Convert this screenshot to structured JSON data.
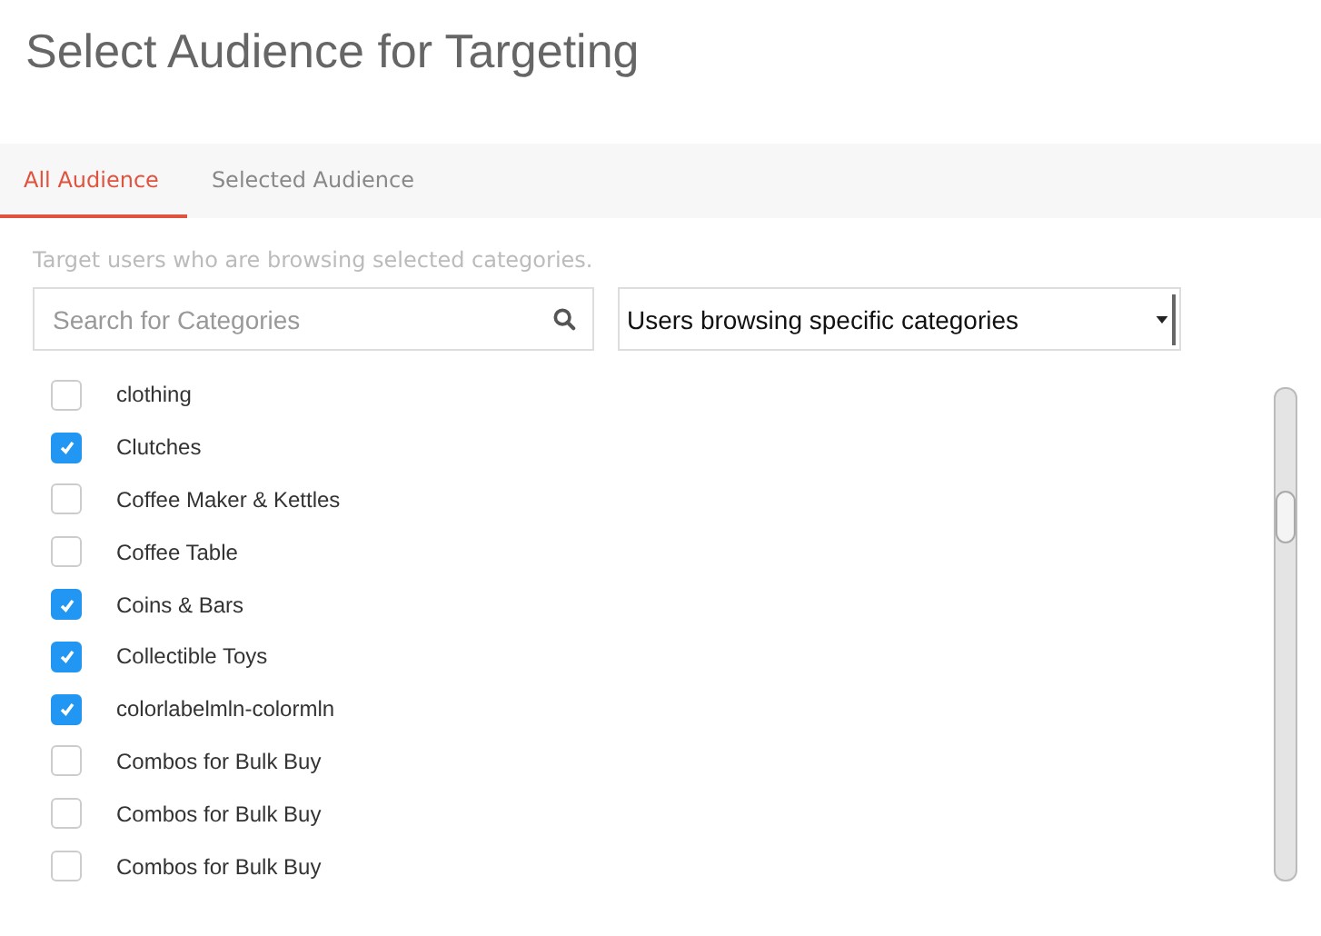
{
  "page": {
    "title": "Select Audience for Targeting"
  },
  "tabs": [
    {
      "label": "All Audience",
      "selected": true
    },
    {
      "label": "Selected Audience",
      "selected": false
    }
  ],
  "hint": "Target users who are browsing selected categories.",
  "search": {
    "placeholder": "Search for Categories"
  },
  "audience_select": {
    "value": "Users browsing specific categories"
  },
  "categories": [
    {
      "label": "clothing",
      "checked": false
    },
    {
      "label": "Clutches",
      "checked": true
    },
    {
      "label": "Coffee Maker & Kettles",
      "checked": false
    },
    {
      "label": "Coffee Table",
      "checked": false
    },
    {
      "label": "Coins & Bars",
      "checked": true
    },
    {
      "label": "Collectible Toys",
      "checked": true
    },
    {
      "label": "colorlabelmln-colormln",
      "checked": true
    },
    {
      "label": "Combos for Bulk Buy",
      "checked": false
    },
    {
      "label": "Combos for Bulk Buy",
      "checked": false
    },
    {
      "label": "Combos for Bulk Buy",
      "checked": false
    }
  ]
}
